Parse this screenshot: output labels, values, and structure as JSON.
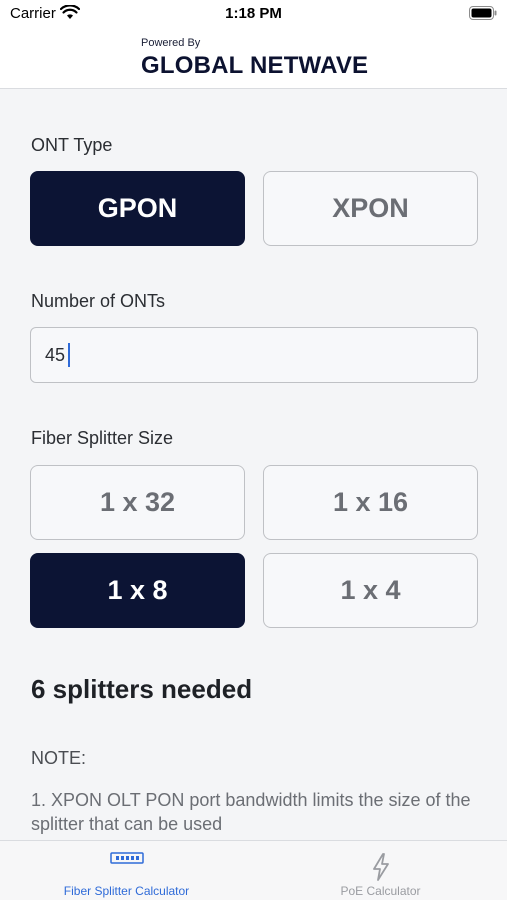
{
  "status_bar": {
    "carrier": "Carrier",
    "time": "1:18 PM"
  },
  "header": {
    "powered_by": "Powered By",
    "brand": "GLOBAL NETWAVE"
  },
  "ont_type": {
    "label": "ONT Type",
    "options": [
      {
        "label": "GPON",
        "selected": true
      },
      {
        "label": "XPON",
        "selected": false
      }
    ]
  },
  "ont_count": {
    "label": "Number of ONTs",
    "value": "45"
  },
  "splitter": {
    "label": "Fiber Splitter Size",
    "options": [
      {
        "label": "1 x 32",
        "selected": false
      },
      {
        "label": "1 x 16",
        "selected": false
      },
      {
        "label": "1 x 8",
        "selected": true
      },
      {
        "label": "1 x 4",
        "selected": false
      }
    ]
  },
  "result": "6 splitters needed",
  "note": {
    "title": "NOTE:",
    "text": "1. XPON OLT PON port bandwidth limits the size of the splitter that can be used"
  },
  "tabs": [
    {
      "label": "Fiber Splitter Calculator",
      "icon": "fiber-splitter-icon",
      "active": true
    },
    {
      "label": "PoE Calculator",
      "icon": "lightning-bolt-icon",
      "active": false
    }
  ],
  "colors": {
    "primary": "#0c1434",
    "accent": "#2f6bd8",
    "background": "#f4f5f7"
  }
}
